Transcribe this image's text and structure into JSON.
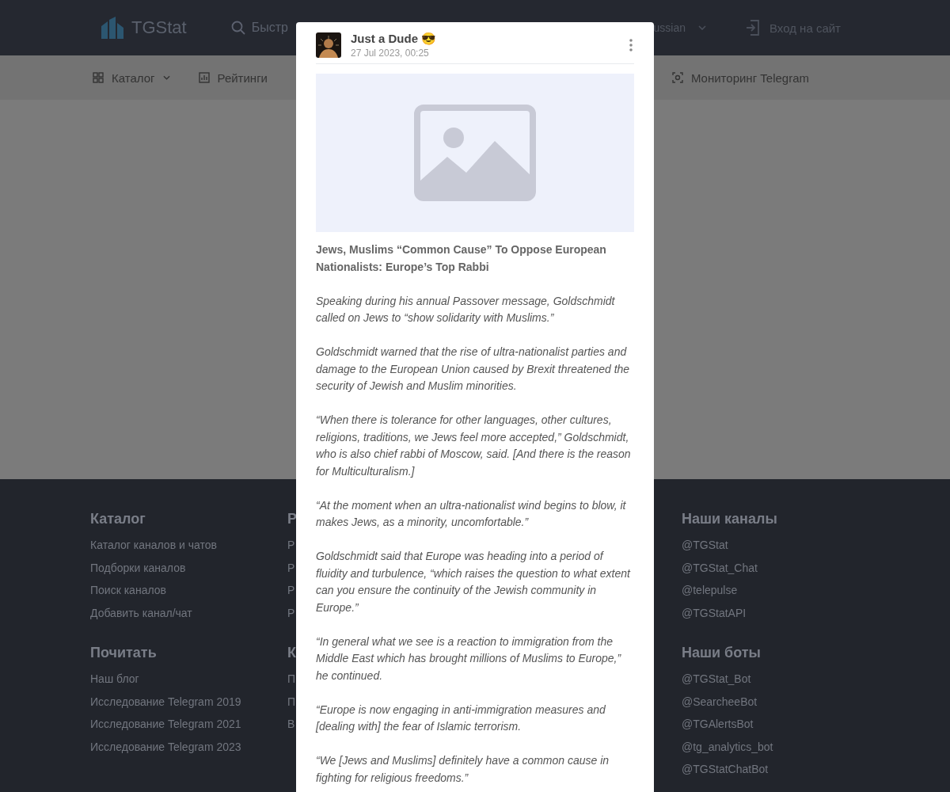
{
  "header": {
    "logo": "TGStat",
    "search": {
      "placeholder": "Быстр"
    },
    "language": "ussian",
    "login": "Вход на сайт"
  },
  "nav": [
    {
      "label": "Каталог",
      "kind": "dropdown"
    },
    {
      "label": "Рейтинги",
      "kind": "link"
    },
    {
      "label": "Мониторинг Telegram",
      "kind": "link"
    }
  ],
  "footer": {
    "columns": [
      {
        "sections": [
          {
            "title": "Каталог",
            "links": [
              "Каталог каналов и чатов",
              "Подборки каналов",
              "Поиск каналов",
              "Добавить канал/чат"
            ]
          },
          {
            "title": "Почитать",
            "links": [
              "Наш блог",
              "Исследование Telegram 2019",
              "Исследование Telegram 2021",
              "Исследование Telegram 2023"
            ]
          }
        ]
      },
      {
        "sections": [
          {
            "title": "Р",
            "links": [
              "Р",
              "Р",
              "Р",
              "Р"
            ]
          },
          {
            "title": "К",
            "links": [
              "П",
              "П",
              "В"
            ]
          }
        ]
      },
      {
        "sections": [
          {
            "title": "Наши каналы",
            "links": [
              "@TGStat",
              "@TGStat_Chat",
              "@telepulse",
              "@TGStatAPI"
            ]
          },
          {
            "title": "Наши боты",
            "links": [
              "@TGStat_Bot",
              "@SearcheeBot",
              "@TGAlertsBot",
              "@tg_analytics_bot",
              "@TGStatChatBot"
            ]
          }
        ]
      }
    ]
  },
  "post": {
    "author": "Just a Dude 😎",
    "date": "27 Jul 2023, 00:25",
    "media": {
      "kind": "picture_placeholder"
    },
    "paragraphs": [
      {
        "kind": "title",
        "text": "Jews, Muslims “Common Cause” To Oppose European Nationalists: Europe’s Top Rabbi"
      },
      {
        "kind": "quote",
        "text": "Speaking during his annual Passover message, Goldschmidt called on Jews to “show solidarity with Muslims.”"
      },
      {
        "kind": "quote",
        "text": "Goldschmidt warned that the rise of ultra-nationalist parties and damage to the European Union caused by Brexit threatened the security of Jewish and Muslim minorities."
      },
      {
        "kind": "quote",
        "text": "“When there is tolerance for other languages, other cultures, religions, traditions, we Jews feel more accepted,” Goldschmidt, who is also chief rabbi of Moscow, said. [And there is the reason for Multiculturalism.]"
      },
      {
        "kind": "quote",
        "text": "“At the moment when an ultra-nationalist wind begins to blow, it makes Jews, as a minority, uncomfortable.”"
      },
      {
        "kind": "quote",
        "text": "Goldschmidt said that Europe was heading into a period of fluidity and turbulence, “which raises the question to what extent can you ensure the continuity of the Jewish community in Europe.”"
      },
      {
        "kind": "quote",
        "text": "“In general what we see is a reaction to immigration from the Middle East which has brought millions of Muslims to Europe,” he continued."
      },
      {
        "kind": "quote",
        "text": "“Europe is now engaging in anti-immigration measures and [dealing with] the fear of Islamic terrorism."
      },
      {
        "kind": "quote",
        "text": "“We [Jews and Muslims] definitely have a common cause in fighting for religious freedoms.”"
      }
    ]
  }
}
